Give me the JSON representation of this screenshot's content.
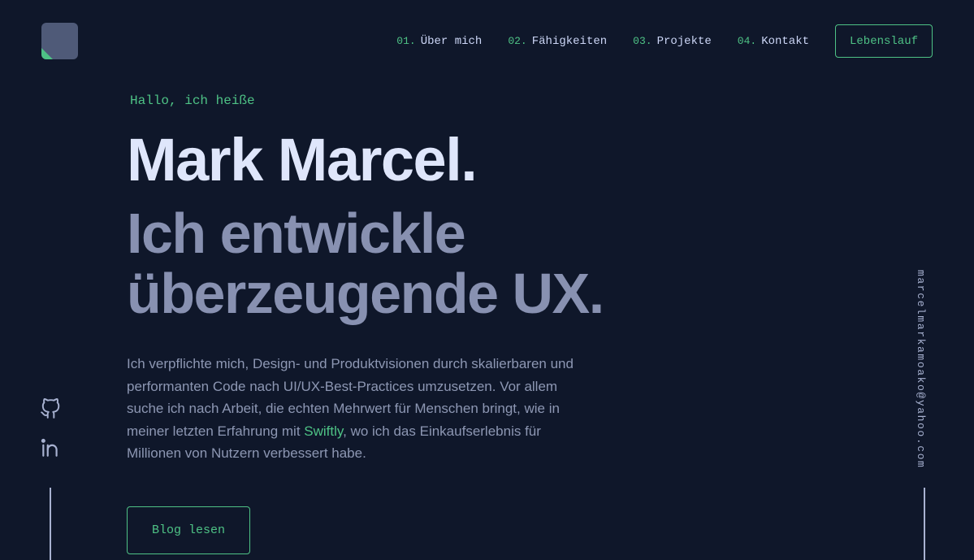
{
  "nav": {
    "items": [
      {
        "num": "01.",
        "label": "Über mich"
      },
      {
        "num": "02.",
        "label": "Fähigkeiten"
      },
      {
        "num": "03.",
        "label": "Projekte"
      },
      {
        "num": "04.",
        "label": "Kontakt"
      }
    ],
    "resume_label": "Lebenslauf"
  },
  "hero": {
    "greeting": "Hallo, ich heiße",
    "name": "Mark Marcel.",
    "tagline_line1": "Ich entwickle",
    "tagline_line2": "überzeugende UX.",
    "intro_before": "Ich verpflichte mich, Design- und Produktvisionen durch skalierbaren und performanten Code nach UI/UX-Best-Practices umzusetzen. Vor allem suche ich nach Arbeit, die echten Mehrwert für Menschen bringt, wie in meiner letzten Erfahrung mit ",
    "intro_link": "Swiftly",
    "intro_after": ", wo ich das Einkaufserlebnis für Millionen von Nutzern verbessert habe.",
    "cta_label": "Blog lesen"
  },
  "sidebar": {
    "email": "marcelmarkamoako@yahoo.com",
    "socials": [
      "github-icon",
      "linkedin-icon"
    ]
  },
  "colors": {
    "background": "#0f172a",
    "accent": "#4ec285",
    "heading": "#dfe6fb",
    "subheading": "#8891b1",
    "body_text": "#8d97b3"
  }
}
